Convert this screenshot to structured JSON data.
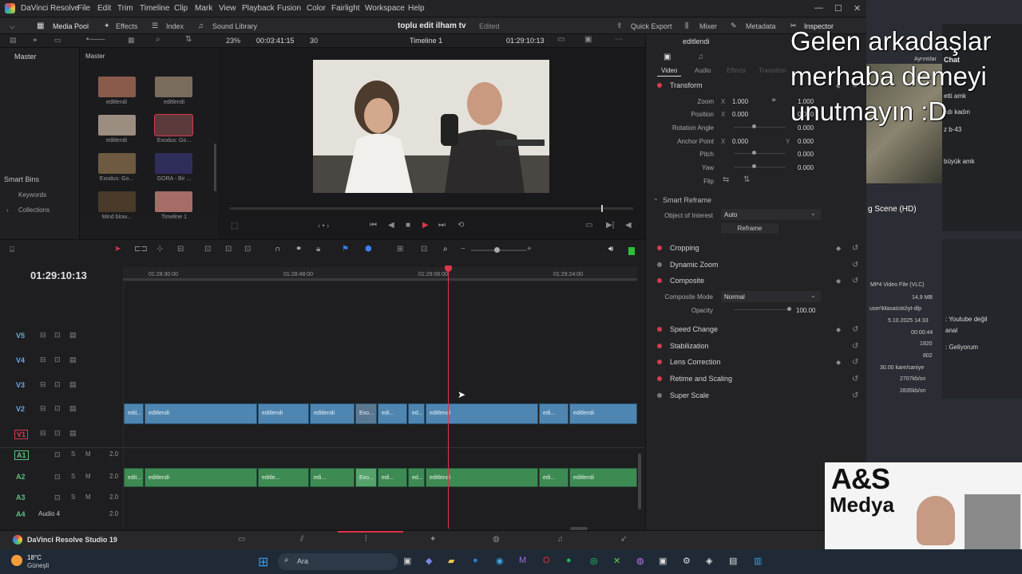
{
  "app": {
    "name": "DaVinci Resolve",
    "project_title": "toplu edit ilham tv",
    "edited_status": "Edited",
    "studio_label": "DaVinci Resolve Studio 19"
  },
  "menu": [
    "File",
    "Edit",
    "Trim",
    "Timeline",
    "Clip",
    "Mark",
    "View",
    "Playback",
    "Fusion",
    "Color",
    "Fairlight",
    "Workspace",
    "Help"
  ],
  "toolbar": {
    "media_pool": "Media Pool",
    "effects": "Effects",
    "index": "Index",
    "sound_library": "Sound Library",
    "quick_export": "Quick Export",
    "mixer": "Mixer",
    "metadata": "Metadata",
    "inspector": "Inspector"
  },
  "viewer": {
    "zoom": "23%",
    "duration": "00:03:41:15",
    "frames": "30",
    "timeline_name": "Timeline 1",
    "timecode": "01:29:10:13"
  },
  "left_panel": {
    "master": "Master",
    "smart_bins": "Smart Bins",
    "keywords": "Keywords",
    "collections": "Collections"
  },
  "media_pool": {
    "bin_name": "Master",
    "clips": [
      {
        "label": "editlendi",
        "color": "#8a5a4a"
      },
      {
        "label": "editlendi",
        "color": "#7a6c5c"
      },
      {
        "label": "editlendi",
        "color": "#9b8d80"
      },
      {
        "label": "Exodus: Go...",
        "color": "#5a3a3a"
      },
      {
        "label": "Exodus: Go...",
        "color": "#6d5a40"
      },
      {
        "label": "GORA - Bir ...",
        "color": "#2f2e5a"
      },
      {
        "label": "Mind blow...",
        "color": "#4a3a2a"
      },
      {
        "label": "Timeline 1",
        "color": "#a56d66"
      }
    ]
  },
  "timeline": {
    "timecode": "01:29:10:13",
    "ruler": [
      "01:28:30:00",
      "01:28:48:00",
      "01:29:06:00",
      "01:29:24:00"
    ],
    "video_tracks": [
      "V5",
      "V4",
      "V3",
      "V2",
      "V1"
    ],
    "audio_tracks": [
      {
        "name": "A1",
        "level": "2.0",
        "label": ""
      },
      {
        "name": "A2",
        "level": "2.0",
        "label": ""
      },
      {
        "name": "A3",
        "level": "2.0",
        "label": ""
      },
      {
        "name": "A4",
        "level": "2.0",
        "label": "Audio 4"
      }
    ],
    "video_clips": [
      "edit...",
      "editlendi",
      "editlendi",
      "editlendi",
      "Exo...",
      "edi...",
      "ed...",
      "editlendi",
      "edi...",
      "editlendi"
    ],
    "audio_clips": [
      "edit...",
      "editlendi",
      "editle...",
      "edi...",
      "Exo...",
      "edi...",
      "ed...",
      "editlendi",
      "edi...",
      "editlendi"
    ]
  },
  "inspector": {
    "clip_name": "editlendi",
    "tabs": [
      "Video",
      "Audio",
      "Effects",
      "Transition"
    ],
    "transform": "Transform",
    "params": [
      {
        "name": "Zoom",
        "x": "1.000",
        "y": "1.000"
      },
      {
        "name": "Position",
        "x": "0.000",
        "y": "0.000"
      },
      {
        "name": "Rotation Angle",
        "x": "",
        "y": "0.000"
      },
      {
        "name": "Anchor Point",
        "x": "0.000",
        "y": "0.000"
      },
      {
        "name": "Pitch",
        "x": "",
        "y": "0.000"
      },
      {
        "name": "Yaw",
        "x": "",
        "y": "0.000"
      },
      {
        "name": "Flip",
        "x": "",
        "y": ""
      }
    ],
    "smart_reframe": "Smart Reframe",
    "object_of_interest_label": "Object of Interest",
    "object_of_interest": "Auto",
    "reframe_button": "Reframe",
    "sections": [
      "Cropping",
      "Dynamic Zoom",
      "Composite"
    ],
    "composite_mode_label": "Composite Mode",
    "composite_mode": "Normal",
    "opacity_label": "Opacity",
    "opacity": "100.00",
    "more_sections": [
      "Speed Change",
      "Stabilization",
      "Lens Correction",
      "Retime and Scaling",
      "Super Scale"
    ]
  },
  "overlay": {
    "line1": "Gelen arkadaşlar",
    "line2": "merhaba demeyi",
    "line3": "unutmayın :D"
  },
  "right_bg": {
    "ayrintilar": "Ayrıntılar",
    "chat": "Chat",
    "chat1": "etti amk",
    "chat2": "ndı kadın",
    "chat3": "z b-43",
    "chat4": "büyük amk",
    "scene": "g Scene (HD)",
    "file_type": "MP4 Video File (VLC)",
    "file_size": "14,9 MB",
    "file_path": "user\\Masaüstü\\yt-dlp",
    "date": "5.10.2025 14:33",
    "length": "00:00:44",
    "width": "1920",
    "height": "802",
    "fps": "30.00 kare/saniye",
    "bitrate1": "2707kb/sn",
    "bitrate2": "2835kb/sn",
    "msg1": ": Youtube değil",
    "msg1b": "anal",
    "msg2": ": Geliyorum"
  },
  "logo": {
    "line1": "A&S",
    "line2": "Medya"
  },
  "taskbar": {
    "temp": "18°C",
    "weather": "Güneşli",
    "search": "Ara"
  }
}
